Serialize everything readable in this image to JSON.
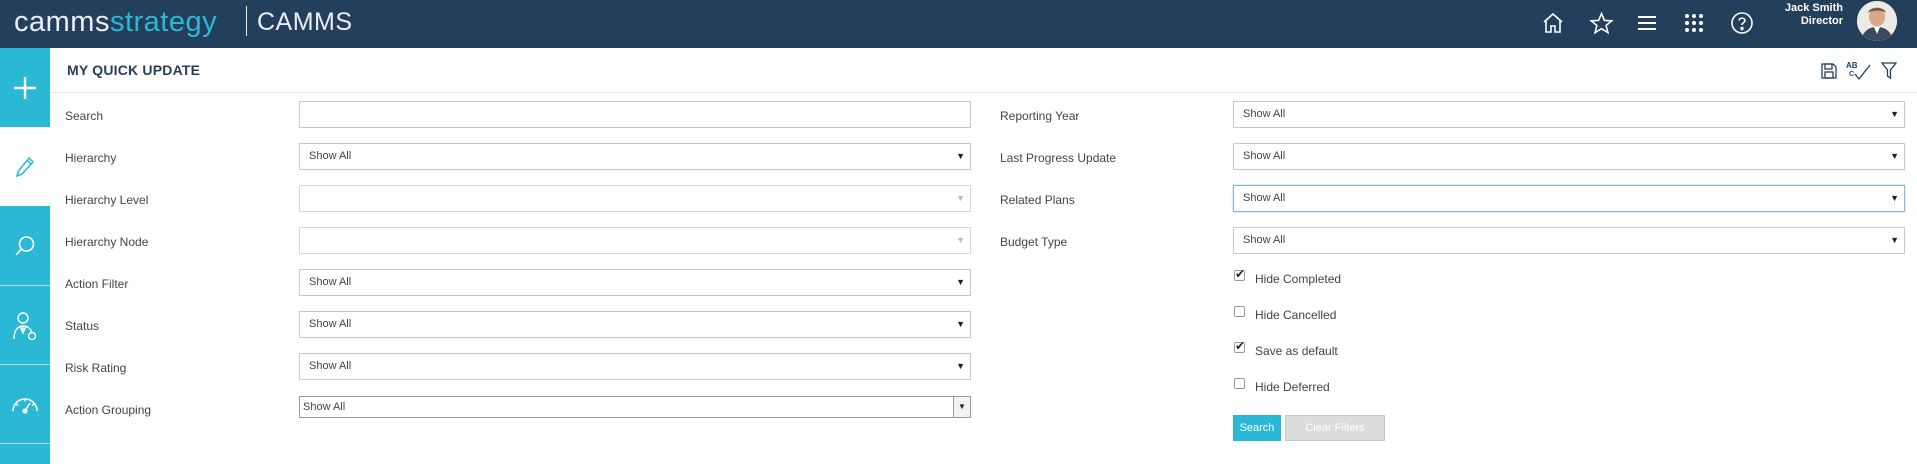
{
  "header": {
    "brand_part1": "camms",
    "brand_part2": "strategy",
    "app_name": "CAMMS",
    "icons": [
      "home-icon",
      "star-icon",
      "menu-icon",
      "apps-grid-icon",
      "help-icon"
    ],
    "user_name": "Jack Smith",
    "user_role": "Director"
  },
  "sidebar": {
    "items": [
      {
        "name": "add-icon"
      },
      {
        "name": "pencil-icon"
      },
      {
        "name": "search-icon"
      },
      {
        "name": "stakeholder-icon"
      },
      {
        "name": "gauge-icon"
      }
    ]
  },
  "page": {
    "title": "MY QUICK UPDATE",
    "toolbar": [
      "save-icon",
      "spellcheck-icon",
      "filter-icon"
    ]
  },
  "filters_left": {
    "search_label": "Search",
    "search_value": "",
    "hierarchy_label": "Hierarchy",
    "hierarchy_value": "Show All",
    "hierarchy_level_label": "Hierarchy Level",
    "hierarchy_level_value": "",
    "hierarchy_node_label": "Hierarchy Node",
    "hierarchy_node_value": "",
    "action_filter_label": "Action Filter",
    "action_filter_value": "Show All",
    "status_label": "Status",
    "status_value": "Show All",
    "risk_rating_label": "Risk Rating",
    "risk_rating_value": "Show All",
    "action_grouping_label": "Action Grouping",
    "action_grouping_value": "Show All"
  },
  "filters_right": {
    "reporting_year_label": "Reporting Year",
    "reporting_year_value": "Show All",
    "last_progress_label": "Last Progress Update",
    "last_progress_value": "Show All",
    "related_plans_label": "Related Plans",
    "related_plans_value": "Show All",
    "budget_type_label": "Budget Type",
    "budget_type_value": "Show All"
  },
  "options": {
    "hide_completed": {
      "label": "Hide Completed",
      "checked": true
    },
    "hide_cancelled": {
      "label": "Hide Cancelled",
      "checked": false
    },
    "save_default": {
      "label": "Save as default",
      "checked": true
    },
    "hide_deferred": {
      "label": "Hide Deferred",
      "checked": false
    }
  },
  "buttons": {
    "search": "Search",
    "clear": "Clear Filters"
  },
  "colors": {
    "header_bg": "#243f5c",
    "accent": "#2ab8d5",
    "title": "#243f5c"
  }
}
